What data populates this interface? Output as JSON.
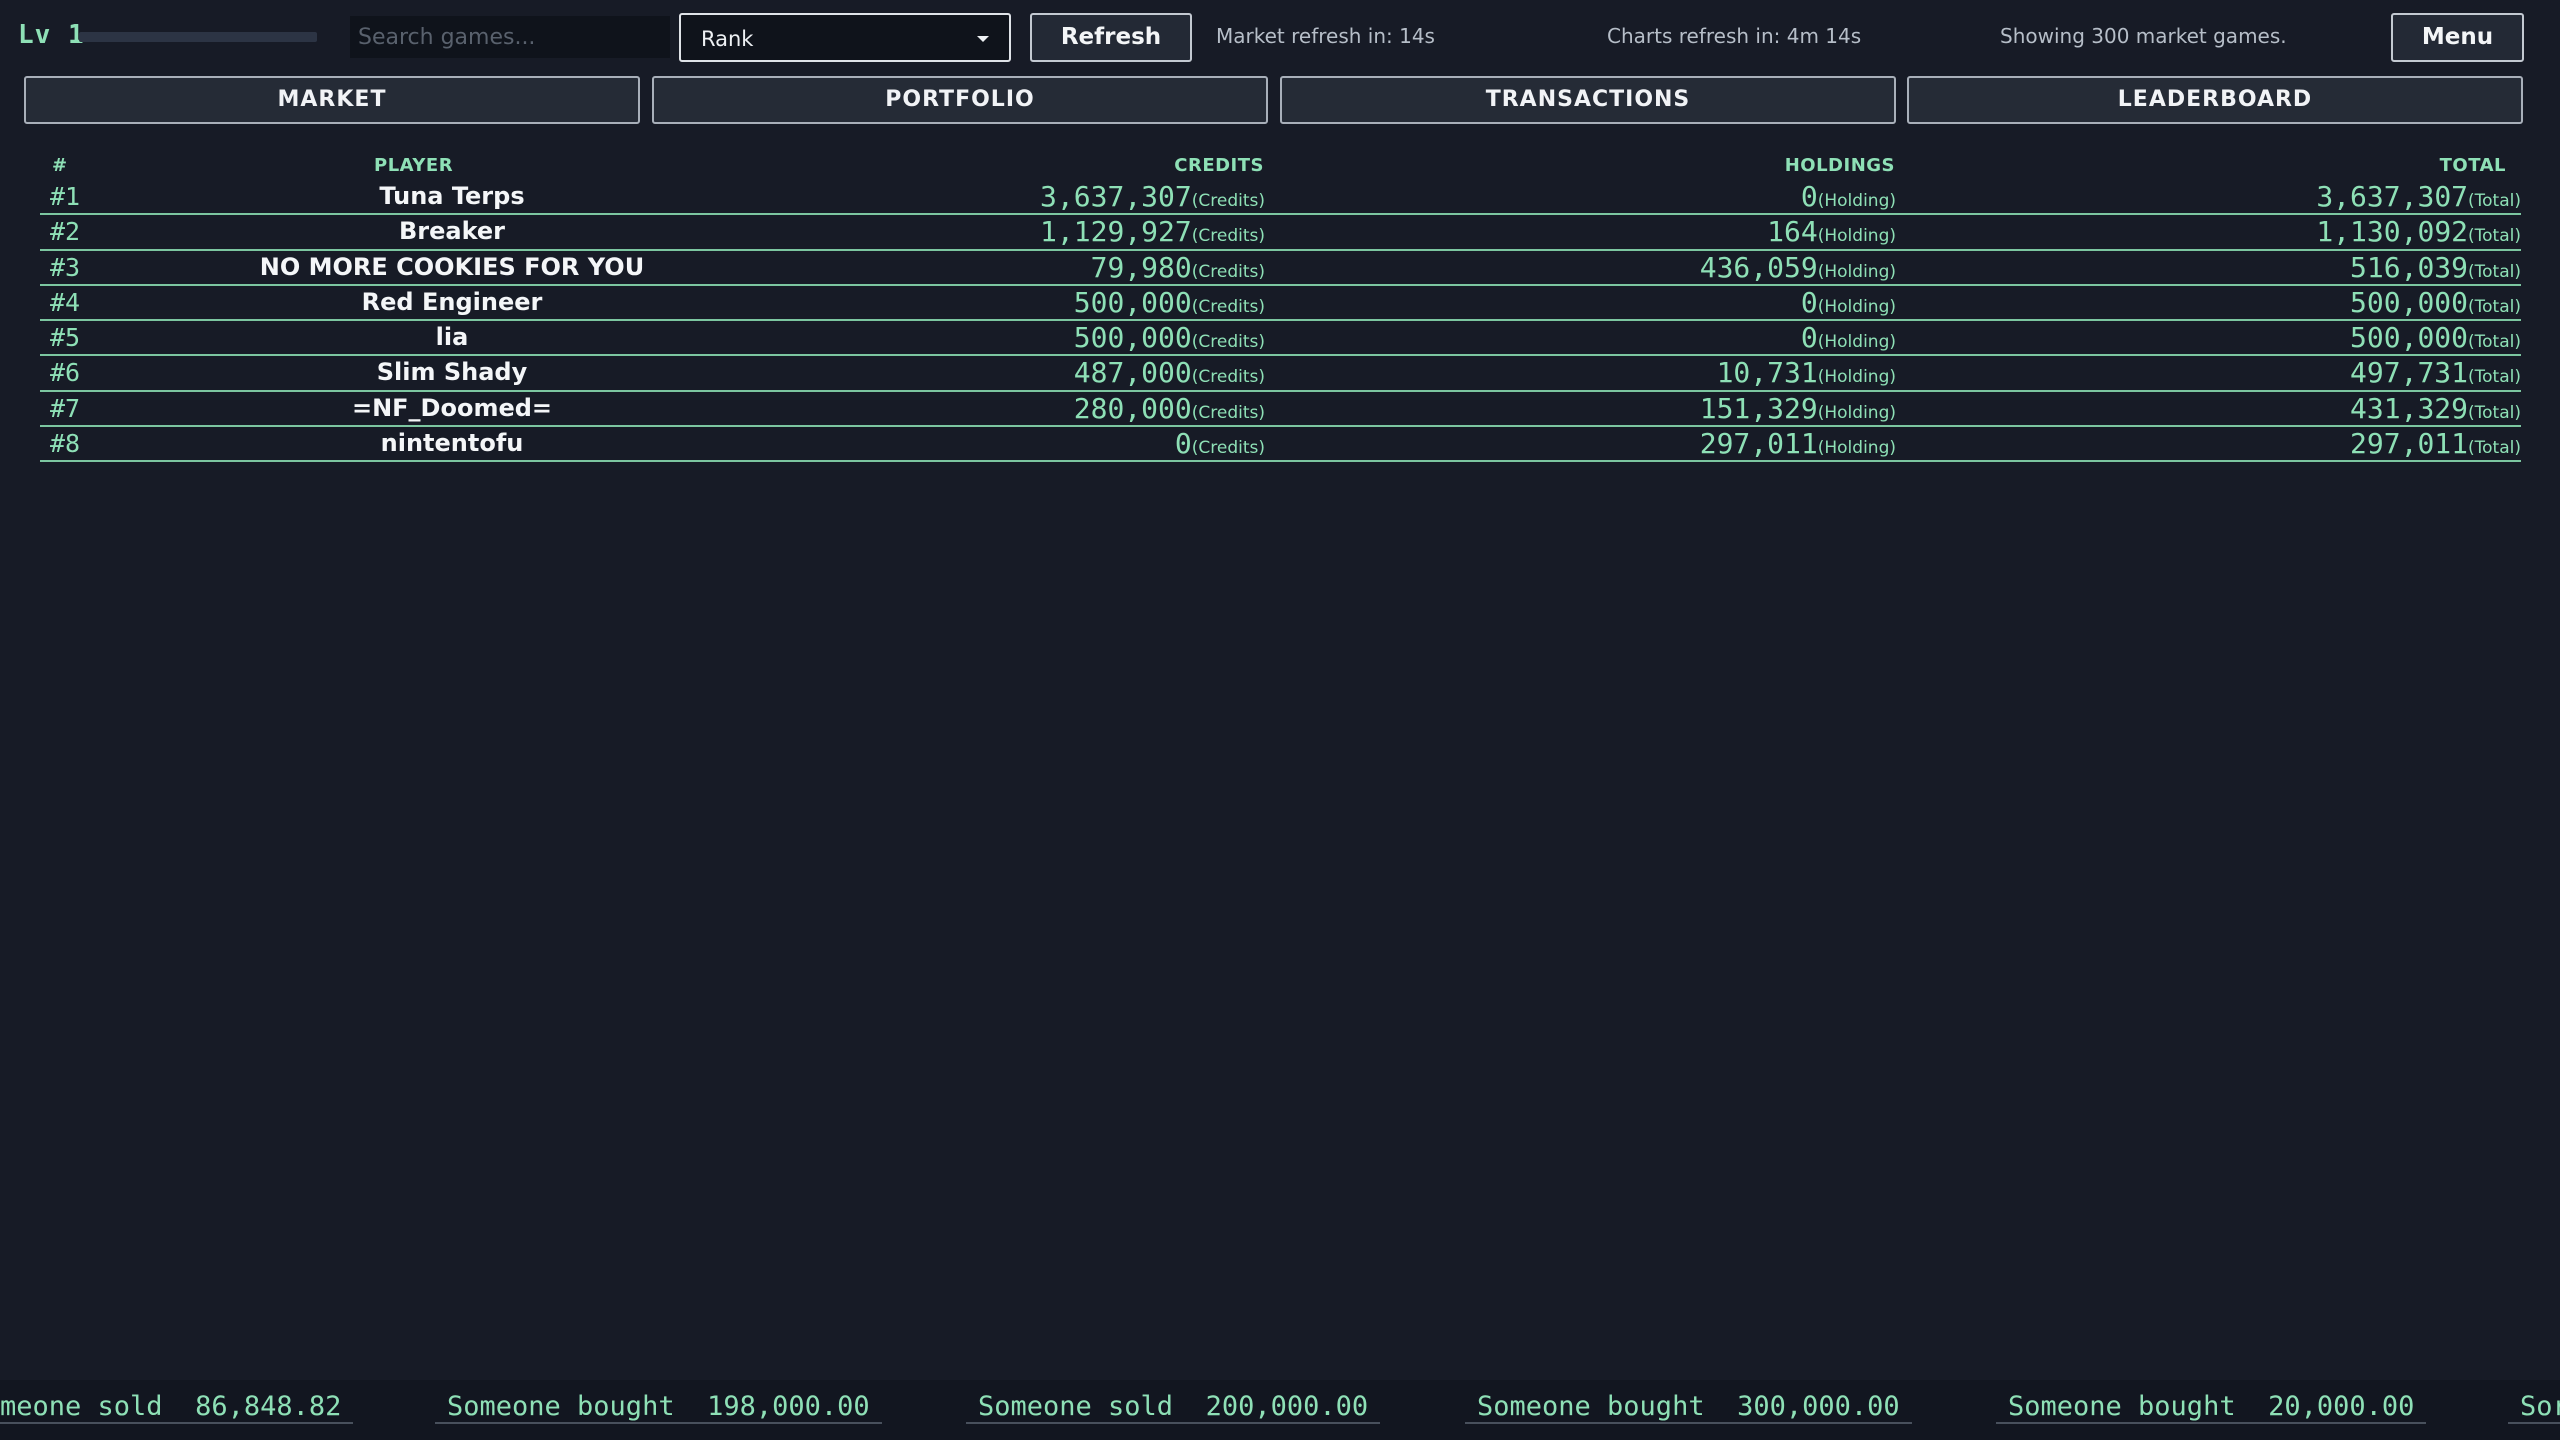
{
  "header": {
    "level_label": "Lv 1",
    "xp_fraction": 0.0,
    "search_placeholder": "Search games...",
    "sort_selected": "Rank",
    "refresh_label": "Refresh",
    "market_refresh": "Market refresh in: 14s",
    "charts_refresh": "Charts refresh in: 4m 14s",
    "showing": "Showing 300 market games.",
    "menu_label": "Menu"
  },
  "tabs": [
    "MARKET",
    "PORTFOLIO",
    "TRANSACTIONS",
    "LEADERBOARD"
  ],
  "table": {
    "columns": [
      "#",
      "PLAYER",
      "CREDITS",
      "HOLDINGS",
      "TOTAL"
    ],
    "unit_credits": "(Credits)",
    "unit_holdings": "(Holding)",
    "unit_total": "(Total)",
    "rows": [
      {
        "rank": "#1",
        "player": "Tuna Terps",
        "credits": "3,637,307",
        "holdings": "0",
        "total": "3,637,307"
      },
      {
        "rank": "#2",
        "player": "Breaker",
        "credits": "1,129,927",
        "holdings": "164",
        "total": "1,130,092"
      },
      {
        "rank": "#3",
        "player": "NO MORE COOKIES FOR YOU",
        "credits": "79,980",
        "holdings": "436,059",
        "total": "516,039"
      },
      {
        "rank": "#4",
        "player": "Red Engineer",
        "credits": "500,000",
        "holdings": "0",
        "total": "500,000"
      },
      {
        "rank": "#5",
        "player": "lia",
        "credits": "500,000",
        "holdings": "0",
        "total": "500,000"
      },
      {
        "rank": "#6",
        "player": "Slim Shady",
        "credits": "487,000",
        "holdings": "10,731",
        "total": "497,731"
      },
      {
        "rank": "#7",
        "player": "=NF_Doomed=",
        "credits": "280,000",
        "holdings": "151,329",
        "total": "431,329"
      },
      {
        "rank": "#8",
        "player": "nintentofu",
        "credits": "0",
        "holdings": "297,011",
        "total": "297,011"
      }
    ]
  },
  "ticker": [
    "meone sold  86,848.82",
    "Someone bought  198,000.00",
    "Someone sold  200,000.00",
    "Someone bought  300,000.00",
    "Someone bought  20,000.00",
    "Sor"
  ],
  "colors": {
    "background": "#171b26",
    "accent": "#8ee0b6"
  }
}
